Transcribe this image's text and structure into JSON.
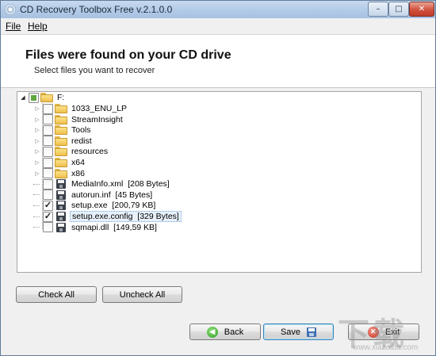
{
  "window": {
    "title": "CD Recovery Toolbox Free v.2.1.0.0",
    "controls": {
      "minimize": "–",
      "maximize": "□",
      "close": "✕"
    }
  },
  "menu": {
    "file": "File",
    "help": "Help"
  },
  "header": {
    "title": "Files were found on your CD drive",
    "subtitle": "Select files you want to recover"
  },
  "tree": {
    "root": {
      "label": "F:",
      "state": "partial"
    },
    "items": [
      {
        "type": "folder",
        "label": "1033_ENU_LP",
        "checked": false
      },
      {
        "type": "folder",
        "label": "StreamInsight",
        "checked": false
      },
      {
        "type": "folder",
        "label": "Tools",
        "checked": false
      },
      {
        "type": "folder",
        "label": "redist",
        "checked": false
      },
      {
        "type": "folder",
        "label": "resources",
        "checked": false
      },
      {
        "type": "folder",
        "label": "x64",
        "checked": false
      },
      {
        "type": "folder",
        "label": "x86",
        "checked": false
      },
      {
        "type": "file",
        "label": "MediaInfo.xml  [208 Bytes]",
        "checked": false
      },
      {
        "type": "file",
        "label": "autorun.inf  [45 Bytes]",
        "checked": false
      },
      {
        "type": "file",
        "label": "setup.exe  [200,79 KB]",
        "checked": true
      },
      {
        "type": "file",
        "label": "setup.exe.config  [329 Bytes]",
        "checked": true,
        "selected": true
      },
      {
        "type": "file",
        "label": "sqmapi.dll  [149,59 KB]",
        "checked": false
      }
    ]
  },
  "buttons": {
    "check_all": "Check All",
    "uncheck_all": "Uncheck All",
    "back": "Back",
    "save": "Save",
    "exit": "Exit"
  },
  "watermark": {
    "text": "下载吧",
    "url": "www.xiazaiba.com"
  },
  "colors": {
    "check_partial": "#5fa83f",
    "selection": "#e7f1fb",
    "close_button": "#d0513c"
  }
}
